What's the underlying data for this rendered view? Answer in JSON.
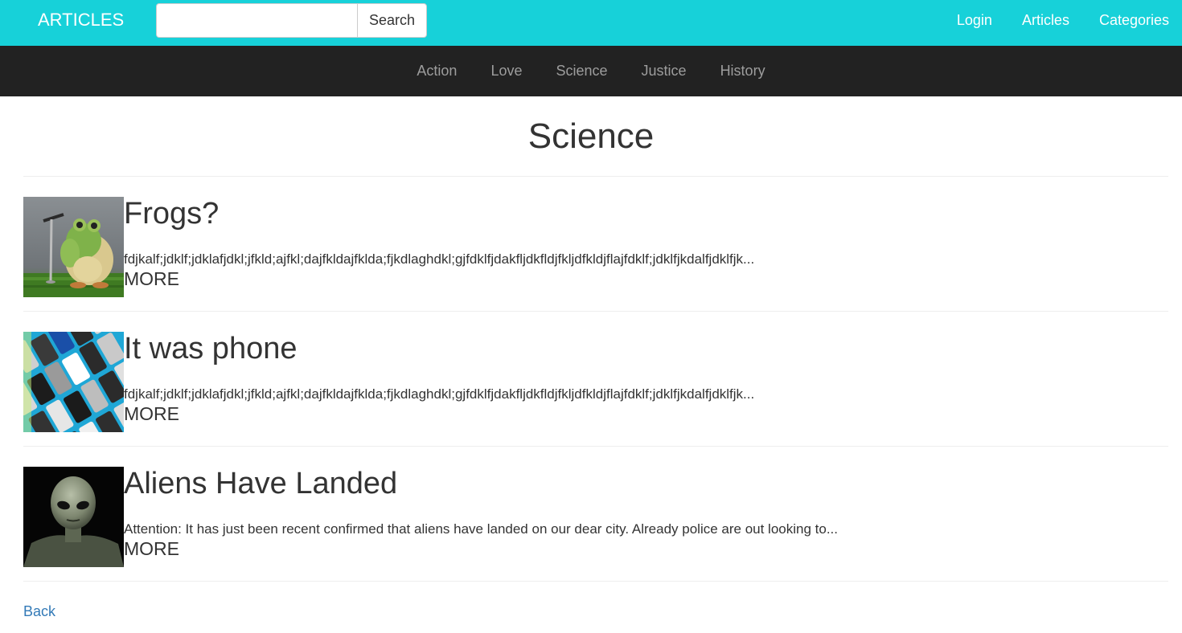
{
  "header": {
    "brand": "ARTICLES",
    "search": {
      "placeholder": "",
      "value": "",
      "button_label": "Search"
    },
    "nav": [
      "Login",
      "Articles",
      "Categories"
    ]
  },
  "categories": [
    "Action",
    "Love",
    "Science",
    "Justice",
    "History"
  ],
  "page": {
    "title": "Science"
  },
  "articles": [
    {
      "title": "Frogs?",
      "excerpt": "fdjkalf;jdklf;jdklafjdkl;jfkld;ajfkl;dajfkldajfklda;fjkdlaghdkl;gjfdklfjdakfljdkfldjfkljdfkldjflajfdklf;jdklfjkdalfjdklfjk...",
      "more": "MORE",
      "image": "frog-image"
    },
    {
      "title": "It was phone",
      "excerpt": "fdjkalf;jdklf;jdklafjdkl;jfkld;ajfkl;dajfkldajfklda;fjkdlaghdkl;gjfdklfjdakfljdkfldjfkljdfkldjflajfdklf;jdklfjkdalfjdklfjk...",
      "more": "MORE",
      "image": "phones-image"
    },
    {
      "title": "Aliens Have Landed",
      "excerpt": "Attention: It has just been recent confirmed that aliens have landed on our dear city. Already police are out looking to...",
      "more": "MORE",
      "image": "alien-image"
    }
  ],
  "footer": {
    "back_label": "Back"
  },
  "colors": {
    "topbar": "#17d1d9",
    "catbar": "#222222",
    "link": "#337ab7"
  }
}
